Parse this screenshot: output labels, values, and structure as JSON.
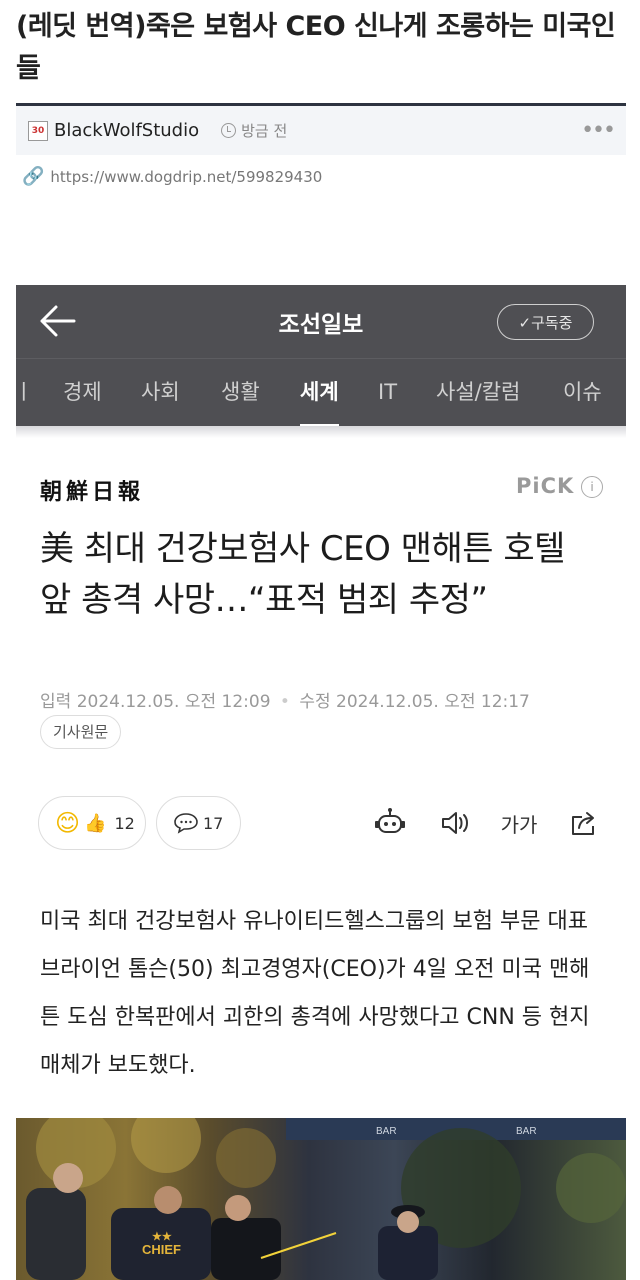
{
  "post": {
    "title": "(레딧 번역)죽은 보험사 CEO 신나게 조롱하는 미국인들",
    "author": "BlackWolfStudio",
    "author_badge": "30",
    "time": "방금 전",
    "link": "https://www.dogdrip.net/599829430"
  },
  "app": {
    "title": "조선일보",
    "subscribe": "✓구독중",
    "tabs": [
      "ㅣ",
      "경제",
      "사회",
      "생활",
      "세계",
      "IT",
      "사설/칼럼",
      "이슈"
    ],
    "active_tab": "세계"
  },
  "article": {
    "brand": "朝鮮日報",
    "pick": "PiCK",
    "headline": "美 최대 건강보험사 CEO 맨해튼 호텔 앞 총격 사망…“표적 범죄 추정”",
    "published_label": "입력",
    "published": "2024.12.05. 오전 12:09",
    "modified_label": "수정",
    "modified": "2024.12.05. 오전 12:17",
    "source_button": "기사원문",
    "reactions": "12",
    "comments": "17",
    "font_size_label": "가가",
    "body": "미국 최대 건강보험사 유나이티드헬스그룹의 보험 부문 대표 브라이언 톰슨(50) 최고경영자(CEO)가 4일 오전 미국 맨해튼 도심 한복판에서 괴한의 총격에 사망했다고 CNN 등 현지 매체가 보도했다."
  },
  "photo": {
    "vest_text": "CHIEF",
    "vest_stars": "★★",
    "bar_sign": "BAR"
  },
  "colors": {
    "header_bg": "#4f4f53",
    "meta_bg": "#f3f5f8"
  }
}
